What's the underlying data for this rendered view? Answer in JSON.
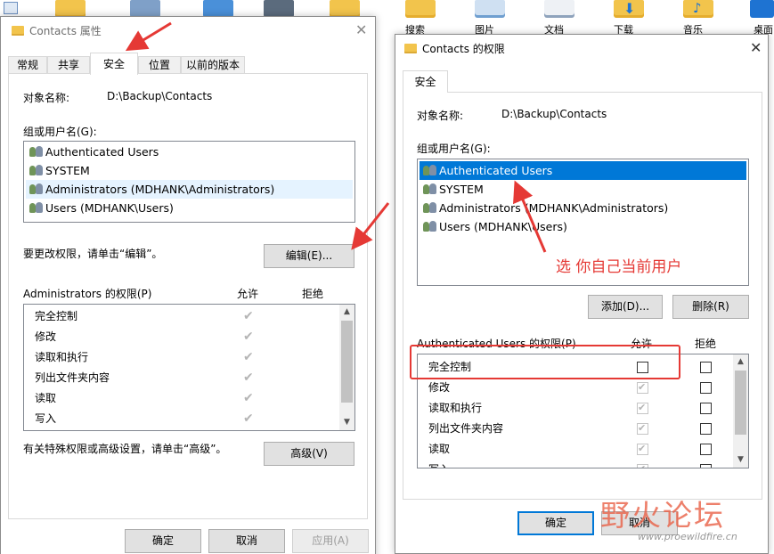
{
  "desktop": {
    "labels": [
      "搜索",
      "图片",
      "文档",
      "下载",
      "音乐",
      "桌面"
    ]
  },
  "left_dialog": {
    "title": "Contacts 属性",
    "tabs": [
      "常规",
      "共享",
      "安全",
      "位置",
      "以前的版本"
    ],
    "object_label": "对象名称:",
    "object_value": "D:\\Backup\\Contacts",
    "group_label": "组或用户名(G):",
    "users": [
      "Authenticated Users",
      "SYSTEM",
      "Administrators (MDHANK\\Administrators)",
      "Users (MDHANK\\Users)"
    ],
    "edit_hint": "要更改权限，请单击“编辑”。",
    "edit_button": "编辑(E)...",
    "perm_header": "Administrators 的权限(P)",
    "allow_header": "允许",
    "deny_header": "拒绝",
    "permissions": [
      "完全控制",
      "修改",
      "读取和执行",
      "列出文件夹内容",
      "读取",
      "写入"
    ],
    "adv_hint": "有关特殊权限或高级设置，请单击“高级”。",
    "advanced_button": "高级(V)",
    "ok_button": "确定",
    "cancel_button": "取消",
    "apply_button": "应用(A)"
  },
  "right_dialog": {
    "title": "Contacts 的权限",
    "tab": "安全",
    "object_label": "对象名称:",
    "object_value": "D:\\Backup\\Contacts",
    "group_label": "组或用户名(G):",
    "users": [
      "Authenticated Users",
      "SYSTEM",
      "Administrators (MDHANK\\Administrators)",
      "Users (MDHANK\\Users)"
    ],
    "add_button": "添加(D)...",
    "remove_button": "删除(R)",
    "perm_header": "Authenticated Users 的权限(P)",
    "allow_header": "允许",
    "deny_header": "拒绝",
    "permissions": [
      "完全控制",
      "修改",
      "读取和执行",
      "列出文件夹内容",
      "读取",
      "写入"
    ],
    "ok_button": "确定",
    "cancel_button": "取消"
  },
  "annotation": {
    "text": "选 你自己当前用户"
  },
  "watermark": {
    "brand": "野火论坛",
    "url": "www.proewildfire.cn"
  },
  "colors": {
    "selection": "#0078d7",
    "annotation": "#e53935"
  }
}
